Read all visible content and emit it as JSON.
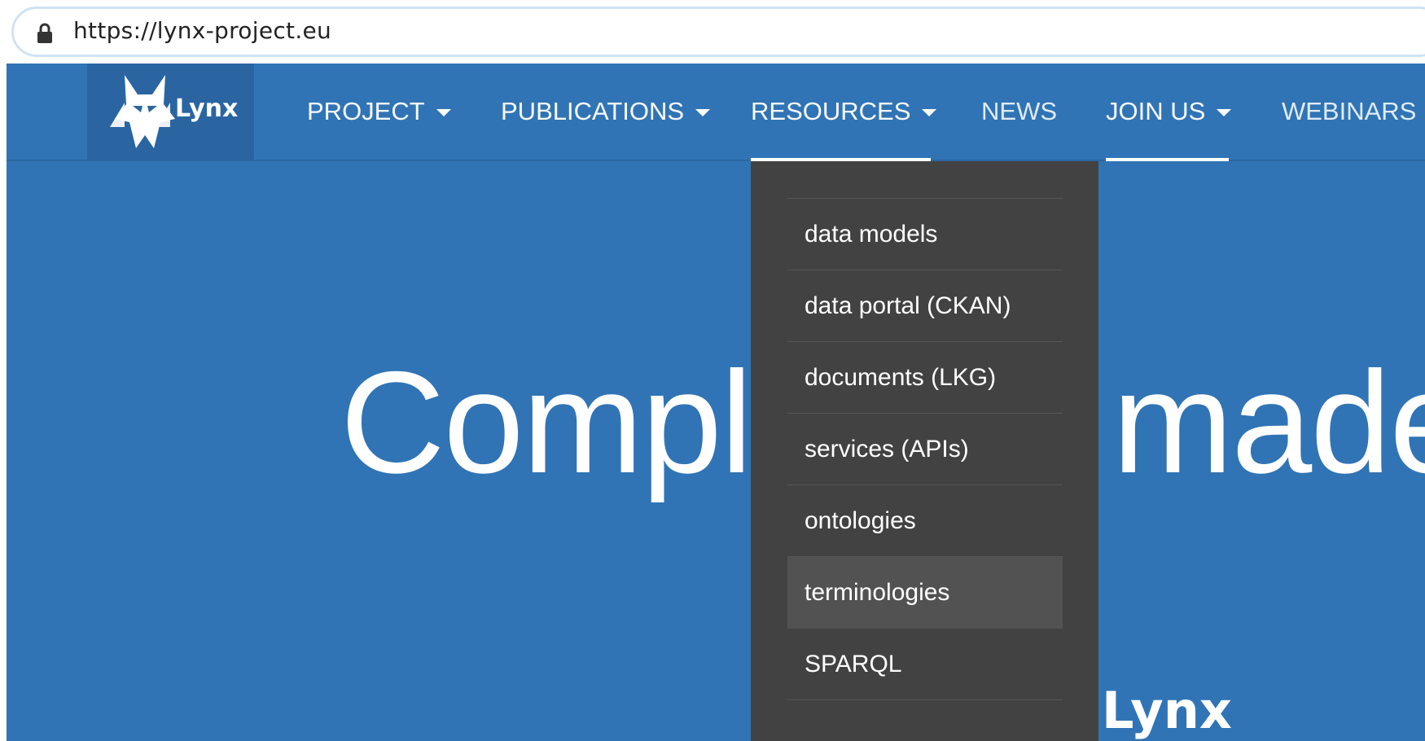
{
  "browser": {
    "url": "https://lynx-project.eu",
    "lock_icon": "lock-icon"
  },
  "site": {
    "logo_text": "Lynx",
    "logo_icon": "lynx-cat-icon",
    "nav": [
      {
        "label": "PROJECT",
        "dropdown": true,
        "active": false
      },
      {
        "label": "PUBLICATIONS",
        "dropdown": true,
        "active": false
      },
      {
        "label": "RESOURCES",
        "dropdown": true,
        "active": true
      },
      {
        "label": "NEWS",
        "dropdown": false,
        "active": false
      },
      {
        "label": "JOIN US",
        "dropdown": true,
        "active": true
      },
      {
        "label": "WEBINARS",
        "dropdown": false,
        "active": false
      }
    ],
    "hero_left": "Compl",
    "hero_right": "made",
    "footer_logo": "Lynx",
    "colors": {
      "brand_blue": "#3074b5",
      "logo_bg": "#2a65a2",
      "dropdown_bg": "#424242",
      "dropdown_hover": "#525252"
    }
  },
  "resources_menu": {
    "items": [
      "data models",
      "data portal (CKAN)",
      "documents (LKG)",
      "services (APIs)",
      "ontologies",
      "terminologies",
      "SPARQL"
    ],
    "hovered": "terminologies"
  }
}
